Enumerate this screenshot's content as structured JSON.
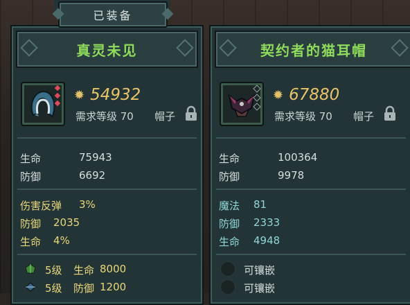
{
  "header": {
    "equipped_tab": "已装备"
  },
  "left_item": {
    "name": "真灵未见",
    "icon": "hood-icon",
    "power": "54932",
    "requirement": "需求等级 70",
    "slot": "帽子",
    "base_stats": [
      {
        "label": "生命",
        "value": "75943"
      },
      {
        "label": "防御",
        "value": "6692"
      }
    ],
    "extra_stats": [
      {
        "label": "伤害反弹",
        "value": "3%"
      },
      {
        "label": "防御",
        "value": "2035"
      },
      {
        "label": "生命",
        "value": "4%"
      }
    ],
    "gems": [
      {
        "level": "5级",
        "label": "生命",
        "value": "8000",
        "icon": "green-gem-icon"
      },
      {
        "level": "5级",
        "label": "防御",
        "value": "1200",
        "icon": "blue-gem-icon"
      }
    ]
  },
  "right_item": {
    "name": "契约者的猫耳帽",
    "icon": "cat-ear-hat-icon",
    "power": "67880",
    "requirement": "需求等级 70",
    "slot": "帽子",
    "base_stats": [
      {
        "label": "生命",
        "value": "100364"
      },
      {
        "label": "防御",
        "value": "9978"
      }
    ],
    "extra_stats": [
      {
        "label": "魔法",
        "value": "81"
      },
      {
        "label": "防御",
        "value": "2333"
      },
      {
        "label": "生命",
        "value": "4948"
      }
    ],
    "sockets": [
      {
        "label": "可镶嵌"
      },
      {
        "label": "可镶嵌"
      }
    ]
  },
  "colors": {
    "title_green": "#8fdc5c",
    "power_gold": "#e7c46a",
    "extra_yellow": "#e9d77c",
    "extra_cyan": "#8fd6d8",
    "stat_white": "#d6dedd"
  }
}
